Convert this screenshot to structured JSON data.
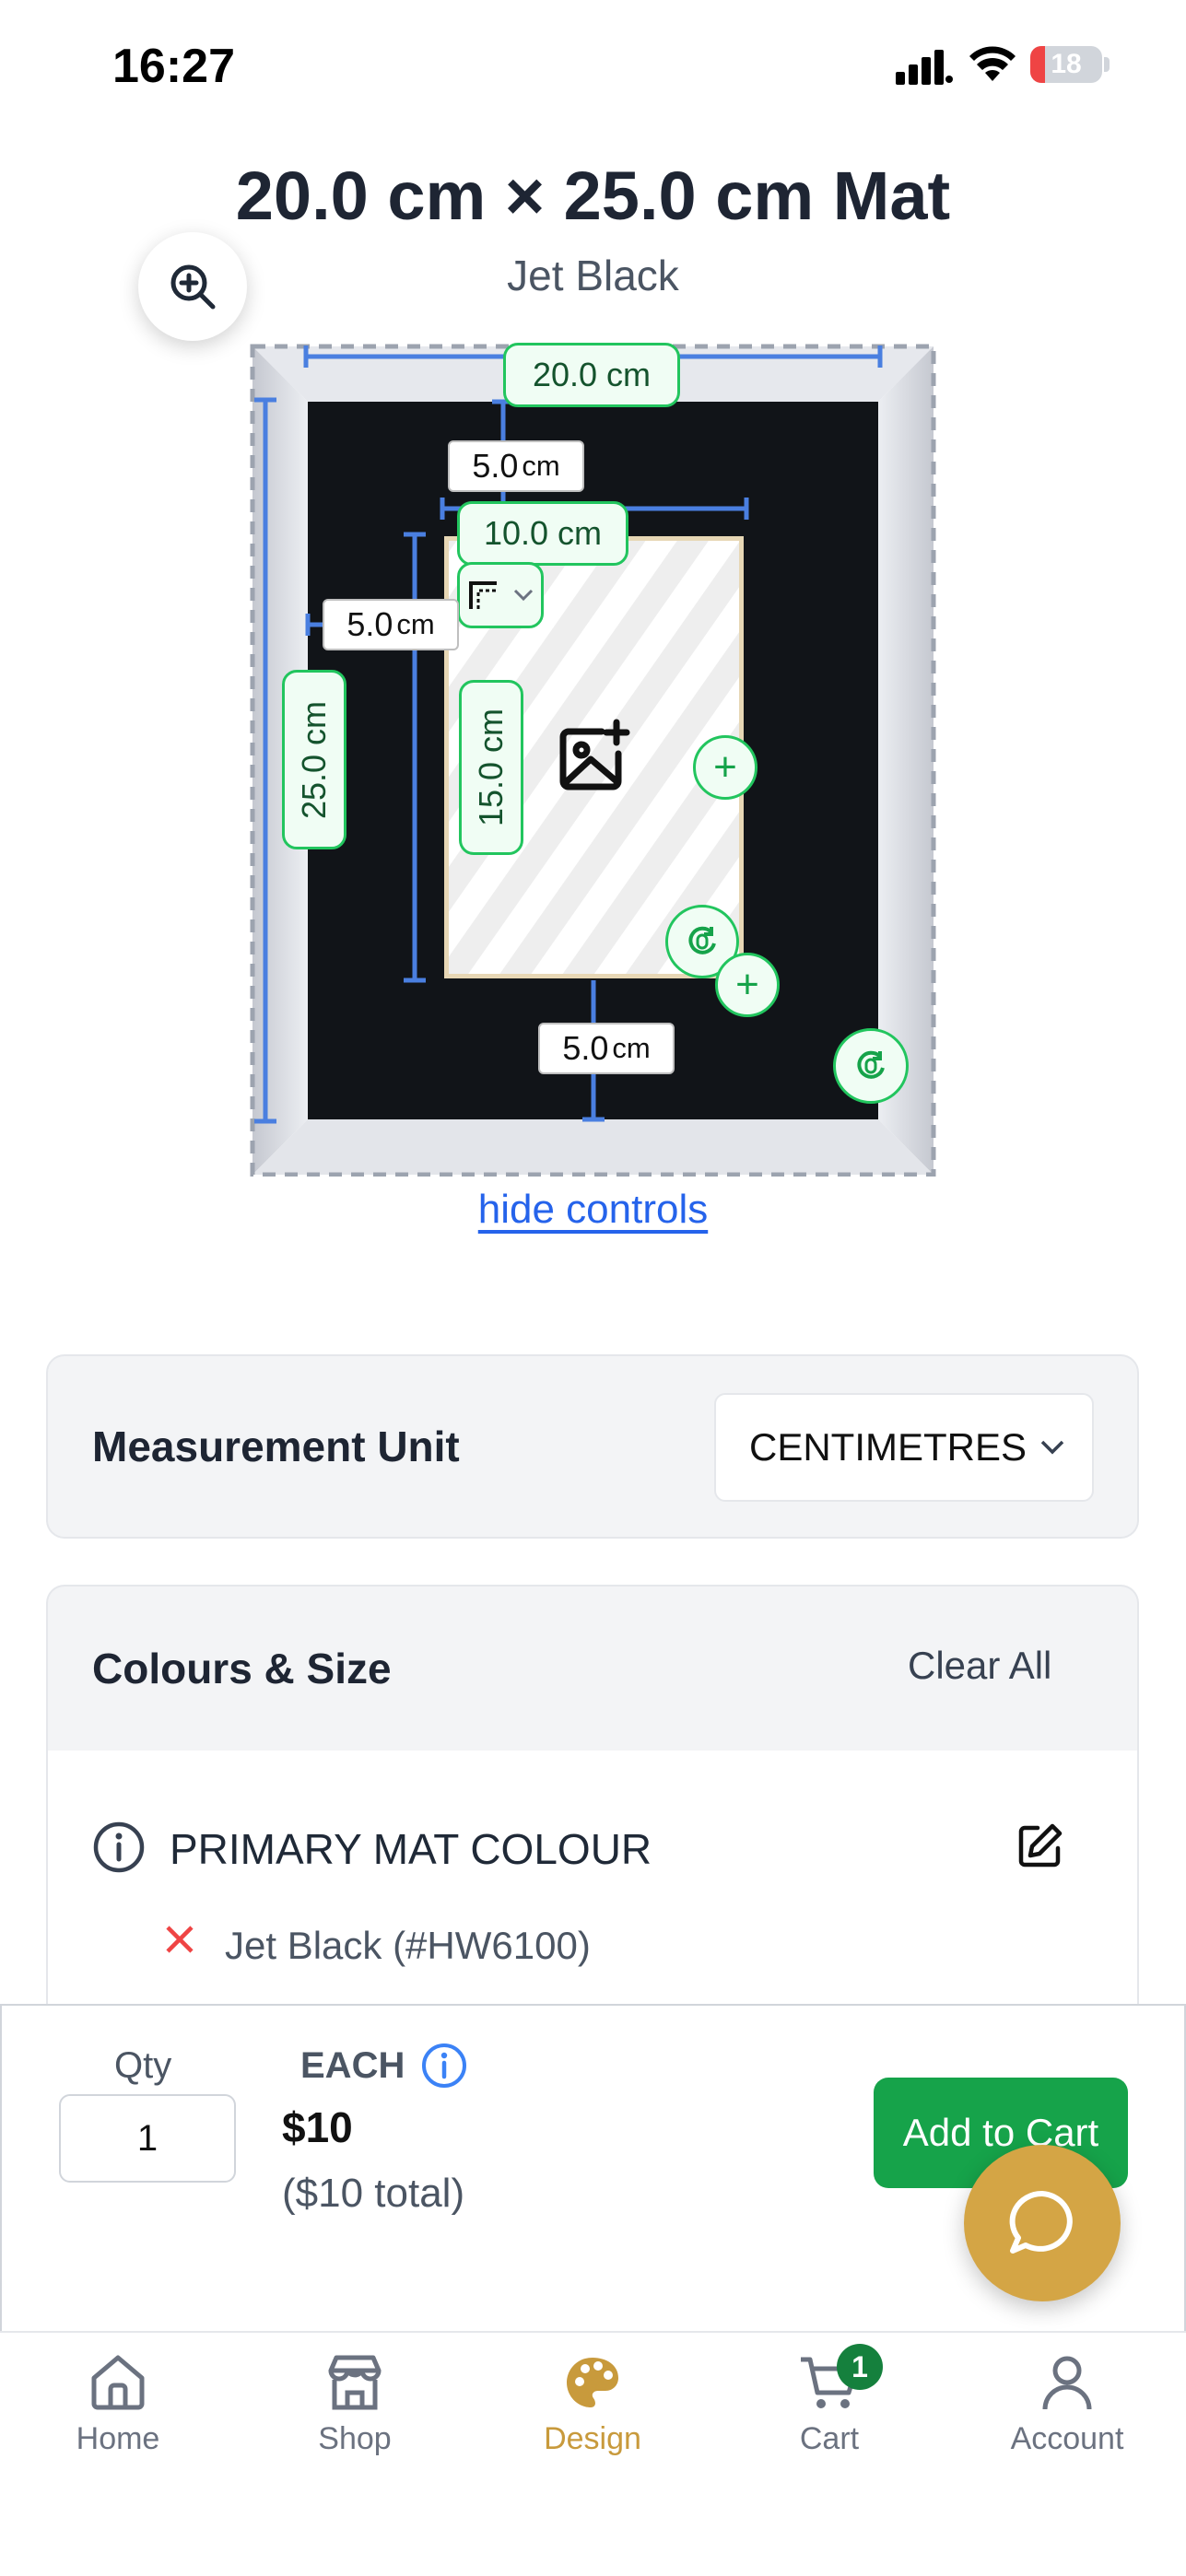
{
  "status_bar": {
    "time": "16:27",
    "battery": "18"
  },
  "header": {
    "title": "20.0 cm × 25.0 cm Mat",
    "subtitle": "Jet Black"
  },
  "preview": {
    "outer_width": "20.0 cm",
    "outer_height": "25.0 cm",
    "opening_width": "10.0 cm",
    "opening_height": "15.0 cm",
    "top_border_value": "5.0",
    "left_border_value": "5.0",
    "bottom_border_value": "5.0",
    "border_unit": "cm",
    "mat_color": "#111418",
    "frame_color": "#d9dbe2",
    "guide_color": "#4a7fe0",
    "accent_green": "#22c55e"
  },
  "hide_controls": "hide controls",
  "measurement": {
    "label": "Measurement Unit",
    "value": "CENTIMETRES"
  },
  "colours": {
    "heading": "Colours & Size",
    "clear_all": "Clear All",
    "primary_label": "PRIMARY MAT COLOUR",
    "primary_value": "Jet Black (#HW6100)"
  },
  "purchase": {
    "qty_label": "Qty",
    "qty_value": "1",
    "each_label": "EACH",
    "price": "$10",
    "total": "($10 total)",
    "add_to_cart": "Add to Cart"
  },
  "tabs": [
    {
      "label": "Home",
      "icon": "home-icon"
    },
    {
      "label": "Shop",
      "icon": "shop-icon"
    },
    {
      "label": "Design",
      "icon": "palette-icon",
      "active": true
    },
    {
      "label": "Cart",
      "icon": "cart-icon",
      "badge": "1"
    },
    {
      "label": "Account",
      "icon": "account-icon"
    }
  ],
  "colors": {
    "brand_gold": "#c89a3c",
    "green": "#16a34a",
    "link_blue": "#2563eb"
  }
}
